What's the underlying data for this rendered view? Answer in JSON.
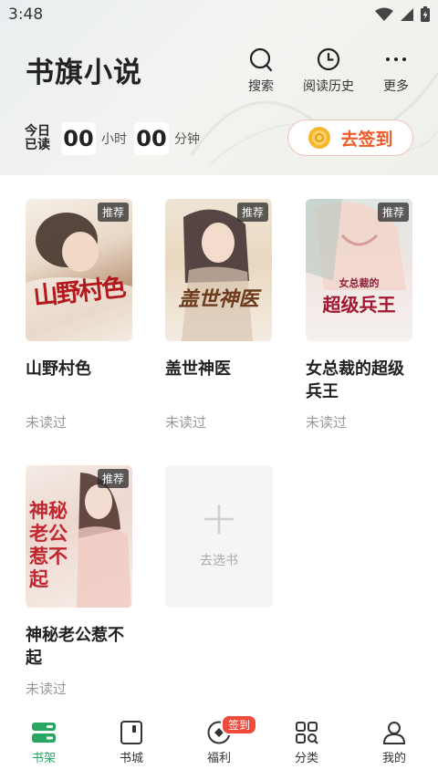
{
  "status_bar": {
    "time": "3:48"
  },
  "header": {
    "app_title": "书旗小说",
    "actions": [
      {
        "label": "搜索",
        "icon": "search-icon"
      },
      {
        "label": "阅读历史",
        "icon": "clock-icon"
      },
      {
        "label": "更多",
        "icon": "more-icon"
      }
    ],
    "today": {
      "label": "今日已读",
      "hours": "00",
      "hours_unit": "小时",
      "minutes": "00",
      "minutes_unit": "分钟"
    },
    "checkin_label": "去签到"
  },
  "books": [
    {
      "title": "山野村色",
      "cover_title": "山野村色",
      "badge": "推荐",
      "status": "未读过"
    },
    {
      "title": "盖世神医",
      "cover_title": "盖世神医",
      "badge": "推荐",
      "status": "未读过"
    },
    {
      "title": "女总裁的超级兵王",
      "cover_title": "超级兵王",
      "cover_subtitle": "女总裁的",
      "badge": "推荐",
      "status": "未读过"
    },
    {
      "title": "神秘老公惹不起",
      "cover_title": "神秘老公惹不起",
      "badge": "推荐",
      "status": "未读过"
    }
  ],
  "add_book_label": "去选书",
  "tabbar": {
    "tabs": [
      {
        "label": "书架",
        "icon": "bookshelf-icon",
        "active": true
      },
      {
        "label": "书城",
        "icon": "bookstore-icon"
      },
      {
        "label": "福利",
        "icon": "welfare-icon",
        "badge": "签到"
      },
      {
        "label": "分类",
        "icon": "category-icon"
      },
      {
        "label": "我的",
        "icon": "profile-icon"
      }
    ]
  },
  "colors": {
    "accent": "#2aa663",
    "checkin": "#f05a28",
    "badge_red": "#f04a3a"
  }
}
